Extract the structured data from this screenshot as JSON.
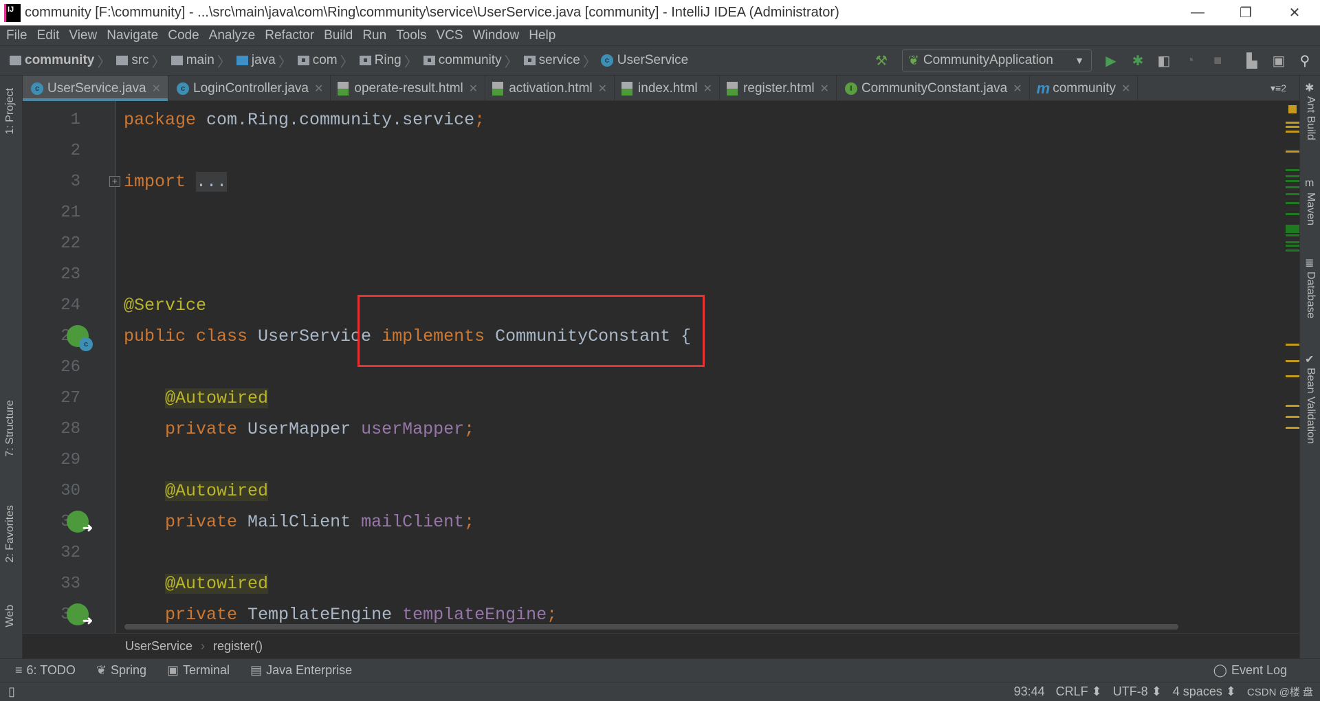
{
  "window": {
    "title": "community [F:\\community] - ...\\src\\main\\java\\com\\Ring\\community\\service\\UserService.java [community] - IntelliJ IDEA (Administrator)",
    "logo": "IJ",
    "minimize": "—",
    "maximize": "❐",
    "close": "✕"
  },
  "menu": [
    "File",
    "Edit",
    "View",
    "Navigate",
    "Code",
    "Analyze",
    "Refactor",
    "Build",
    "Run",
    "Tools",
    "VCS",
    "Window",
    "Help"
  ],
  "nav": {
    "crumbs": [
      "community",
      "src",
      "main",
      "java",
      "com",
      "Ring",
      "community",
      "service",
      "UserService"
    ],
    "run_config": "CommunityApplication"
  },
  "tabs": [
    {
      "label": "UserService.java",
      "icon": "class-icon",
      "active": true
    },
    {
      "label": "LoginController.java",
      "icon": "class-icon"
    },
    {
      "label": "operate-result.html",
      "icon": "html-icon"
    },
    {
      "label": "activation.html",
      "icon": "html-icon"
    },
    {
      "label": "index.html",
      "icon": "html-icon"
    },
    {
      "label": "register.html",
      "icon": "html-icon"
    },
    {
      "label": "CommunityConstant.java",
      "icon": "interface-icon"
    },
    {
      "label": "community",
      "icon": "maven-icon"
    }
  ],
  "tab_overflow": "▾≡2",
  "left_tools": [
    "1: Project",
    "7: Structure",
    "2: Favorites",
    "Web"
  ],
  "right_tools": [
    "Ant Build",
    "Maven",
    "Database",
    "Bean Validation"
  ],
  "code": [
    {
      "n": "1",
      "t": [
        [
          "kw",
          "package"
        ],
        [
          "tx",
          " com.Ring.community.service"
        ],
        [
          "kw",
          ";"
        ]
      ]
    },
    {
      "n": "2",
      "t": []
    },
    {
      "n": "3",
      "fold": true,
      "t": [
        [
          "kw",
          "import"
        ],
        [
          "tx",
          " "
        ],
        [
          "fold",
          "..."
        ]
      ]
    },
    {
      "n": "21",
      "t": []
    },
    {
      "n": "22",
      "t": []
    },
    {
      "n": "23",
      "t": []
    },
    {
      "n": "24",
      "t": [
        [
          "an",
          "@Service"
        ]
      ]
    },
    {
      "n": "25",
      "g": "bean-class",
      "t": [
        [
          "kw",
          "public class"
        ],
        [
          "tx",
          " UserService "
        ],
        [
          "kw",
          "implements"
        ],
        [
          "tx",
          " CommunityConstant {"
        ]
      ]
    },
    {
      "n": "26",
      "t": []
    },
    {
      "n": "27",
      "t": [
        [
          "tx",
          "    "
        ],
        [
          "an anbg",
          "@Autowired"
        ]
      ]
    },
    {
      "n": "28",
      "t": [
        [
          "tx",
          "    "
        ],
        [
          "kw",
          "private"
        ],
        [
          "tx",
          " UserMapper "
        ],
        [
          "fd",
          "userMapper"
        ],
        [
          "kw",
          ";"
        ]
      ]
    },
    {
      "n": "29",
      "t": []
    },
    {
      "n": "30",
      "t": [
        [
          "tx",
          "    "
        ],
        [
          "an anbg",
          "@Autowired"
        ]
      ]
    },
    {
      "n": "31",
      "g": "autowired",
      "t": [
        [
          "tx",
          "    "
        ],
        [
          "kw",
          "private"
        ],
        [
          "tx",
          " MailClient "
        ],
        [
          "fd",
          "mailClient"
        ],
        [
          "kw",
          ";"
        ]
      ]
    },
    {
      "n": "32",
      "t": []
    },
    {
      "n": "33",
      "t": [
        [
          "tx",
          "    "
        ],
        [
          "an anbg",
          "@Autowired"
        ]
      ]
    },
    {
      "n": "34",
      "g": "autowired",
      "t": [
        [
          "tx",
          "    "
        ],
        [
          "kw",
          "private"
        ],
        [
          "tx",
          " TemplateEngine "
        ],
        [
          "fd",
          "templateEngine"
        ],
        [
          "kw",
          ";"
        ]
      ]
    }
  ],
  "breadcrumb": [
    "UserService",
    "register()"
  ],
  "tool_windows": [
    {
      "label": "6: TODO",
      "icon": "≡"
    },
    {
      "label": "Spring",
      "icon": "❦"
    },
    {
      "label": "Terminal",
      "icon": "▣"
    },
    {
      "label": "Java Enterprise",
      "icon": "▤"
    }
  ],
  "event_log": "Event Log",
  "status": {
    "position": "93:44",
    "line_sep": "CRLF ⬍",
    "encoding": "UTF-8 ⬍",
    "indent": "4 spaces ⬍",
    "watermark": "CSDN @楼 盘"
  },
  "colors": {
    "keyword": "#cc7832",
    "annotation": "#bbb529",
    "field": "#9876aa",
    "text": "#a9b7c6",
    "highlight_box": "#e53333"
  }
}
